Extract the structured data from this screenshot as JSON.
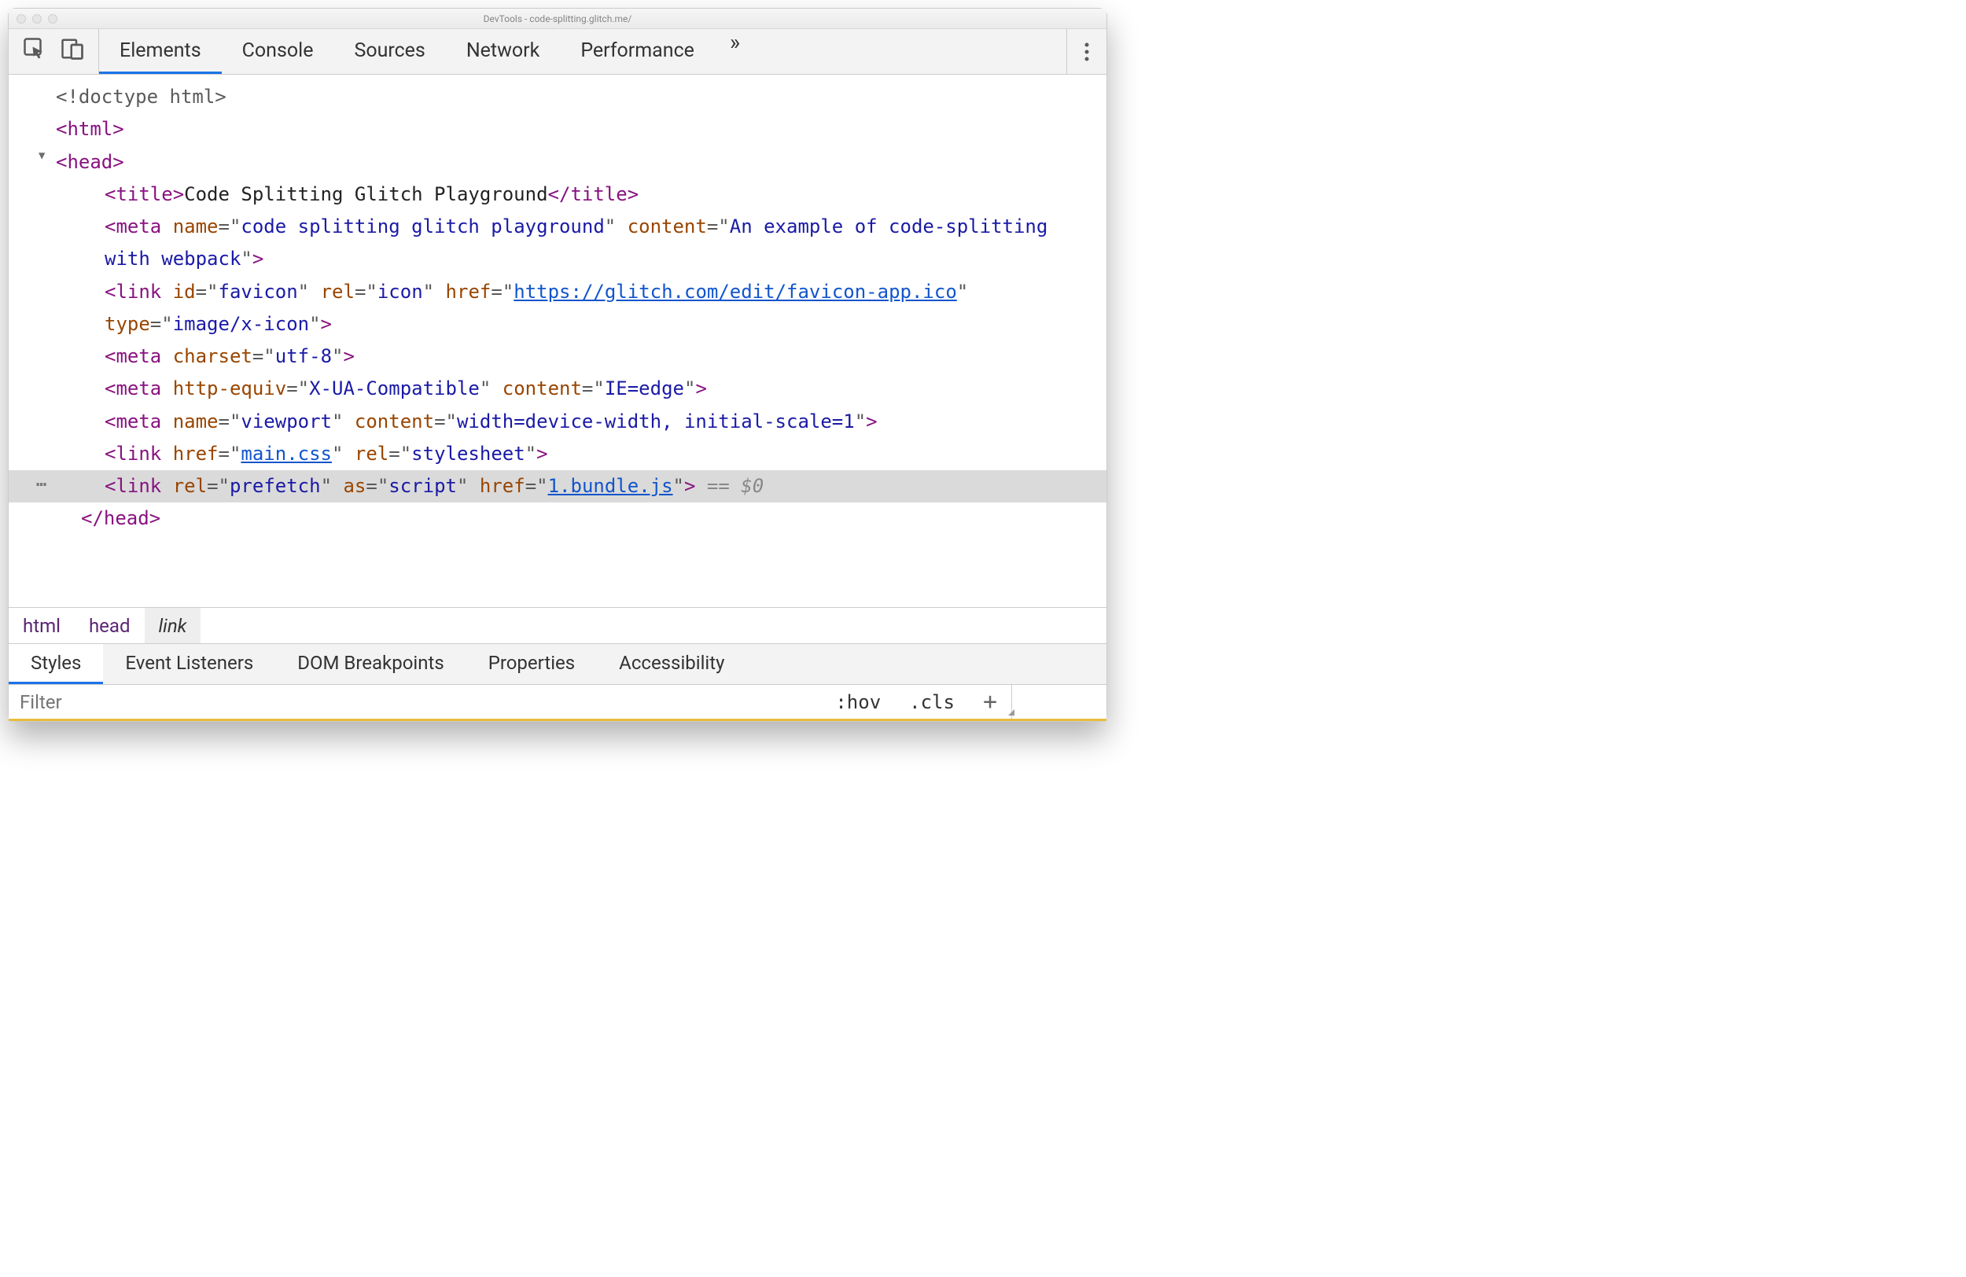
{
  "window": {
    "title": "DevTools - code-splitting.glitch.me/"
  },
  "toolbar": {
    "tabs": [
      "Elements",
      "Console",
      "Sources",
      "Network",
      "Performance"
    ],
    "active_tab": 0
  },
  "dom": {
    "doctype": "<!doctype html>",
    "html_open": "html",
    "head_open": "head",
    "title_tag": "title",
    "title_text": "Code Splitting Glitch Playground",
    "meta1": {
      "tag": "meta",
      "name_attr": "name",
      "name_val": "code splitting glitch playground",
      "content_attr": "content",
      "content_val": "An example of code-splitting with webpack"
    },
    "link_favicon": {
      "tag": "link",
      "id": "favicon",
      "rel": "icon",
      "href": "https://glitch.com/edit/favicon-app.ico",
      "type": "image/x-icon"
    },
    "meta_charset": {
      "tag": "meta",
      "attr": "charset",
      "val": "utf-8"
    },
    "meta_compat": {
      "tag": "meta",
      "attr": "http-equiv",
      "val": "X-UA-Compatible",
      "cattr": "content",
      "cval": "IE=edge"
    },
    "meta_viewport": {
      "tag": "meta",
      "attr": "name",
      "val": "viewport",
      "cattr": "content",
      "cval": "width=device-width, initial-scale=1"
    },
    "link_css": {
      "tag": "link",
      "href": "main.css",
      "rel": "stylesheet"
    },
    "link_prefetch": {
      "tag": "link",
      "rel": "prefetch",
      "as": "script",
      "href": "1.bundle.js"
    },
    "selected_marker": " == $0",
    "head_close": "/head"
  },
  "breadcrumbs": [
    "html",
    "head",
    "link"
  ],
  "subtabs": [
    "Styles",
    "Event Listeners",
    "DOM Breakpoints",
    "Properties",
    "Accessibility"
  ],
  "filter": {
    "placeholder": "Filter",
    "hov": ":hov",
    "cls": ".cls"
  }
}
